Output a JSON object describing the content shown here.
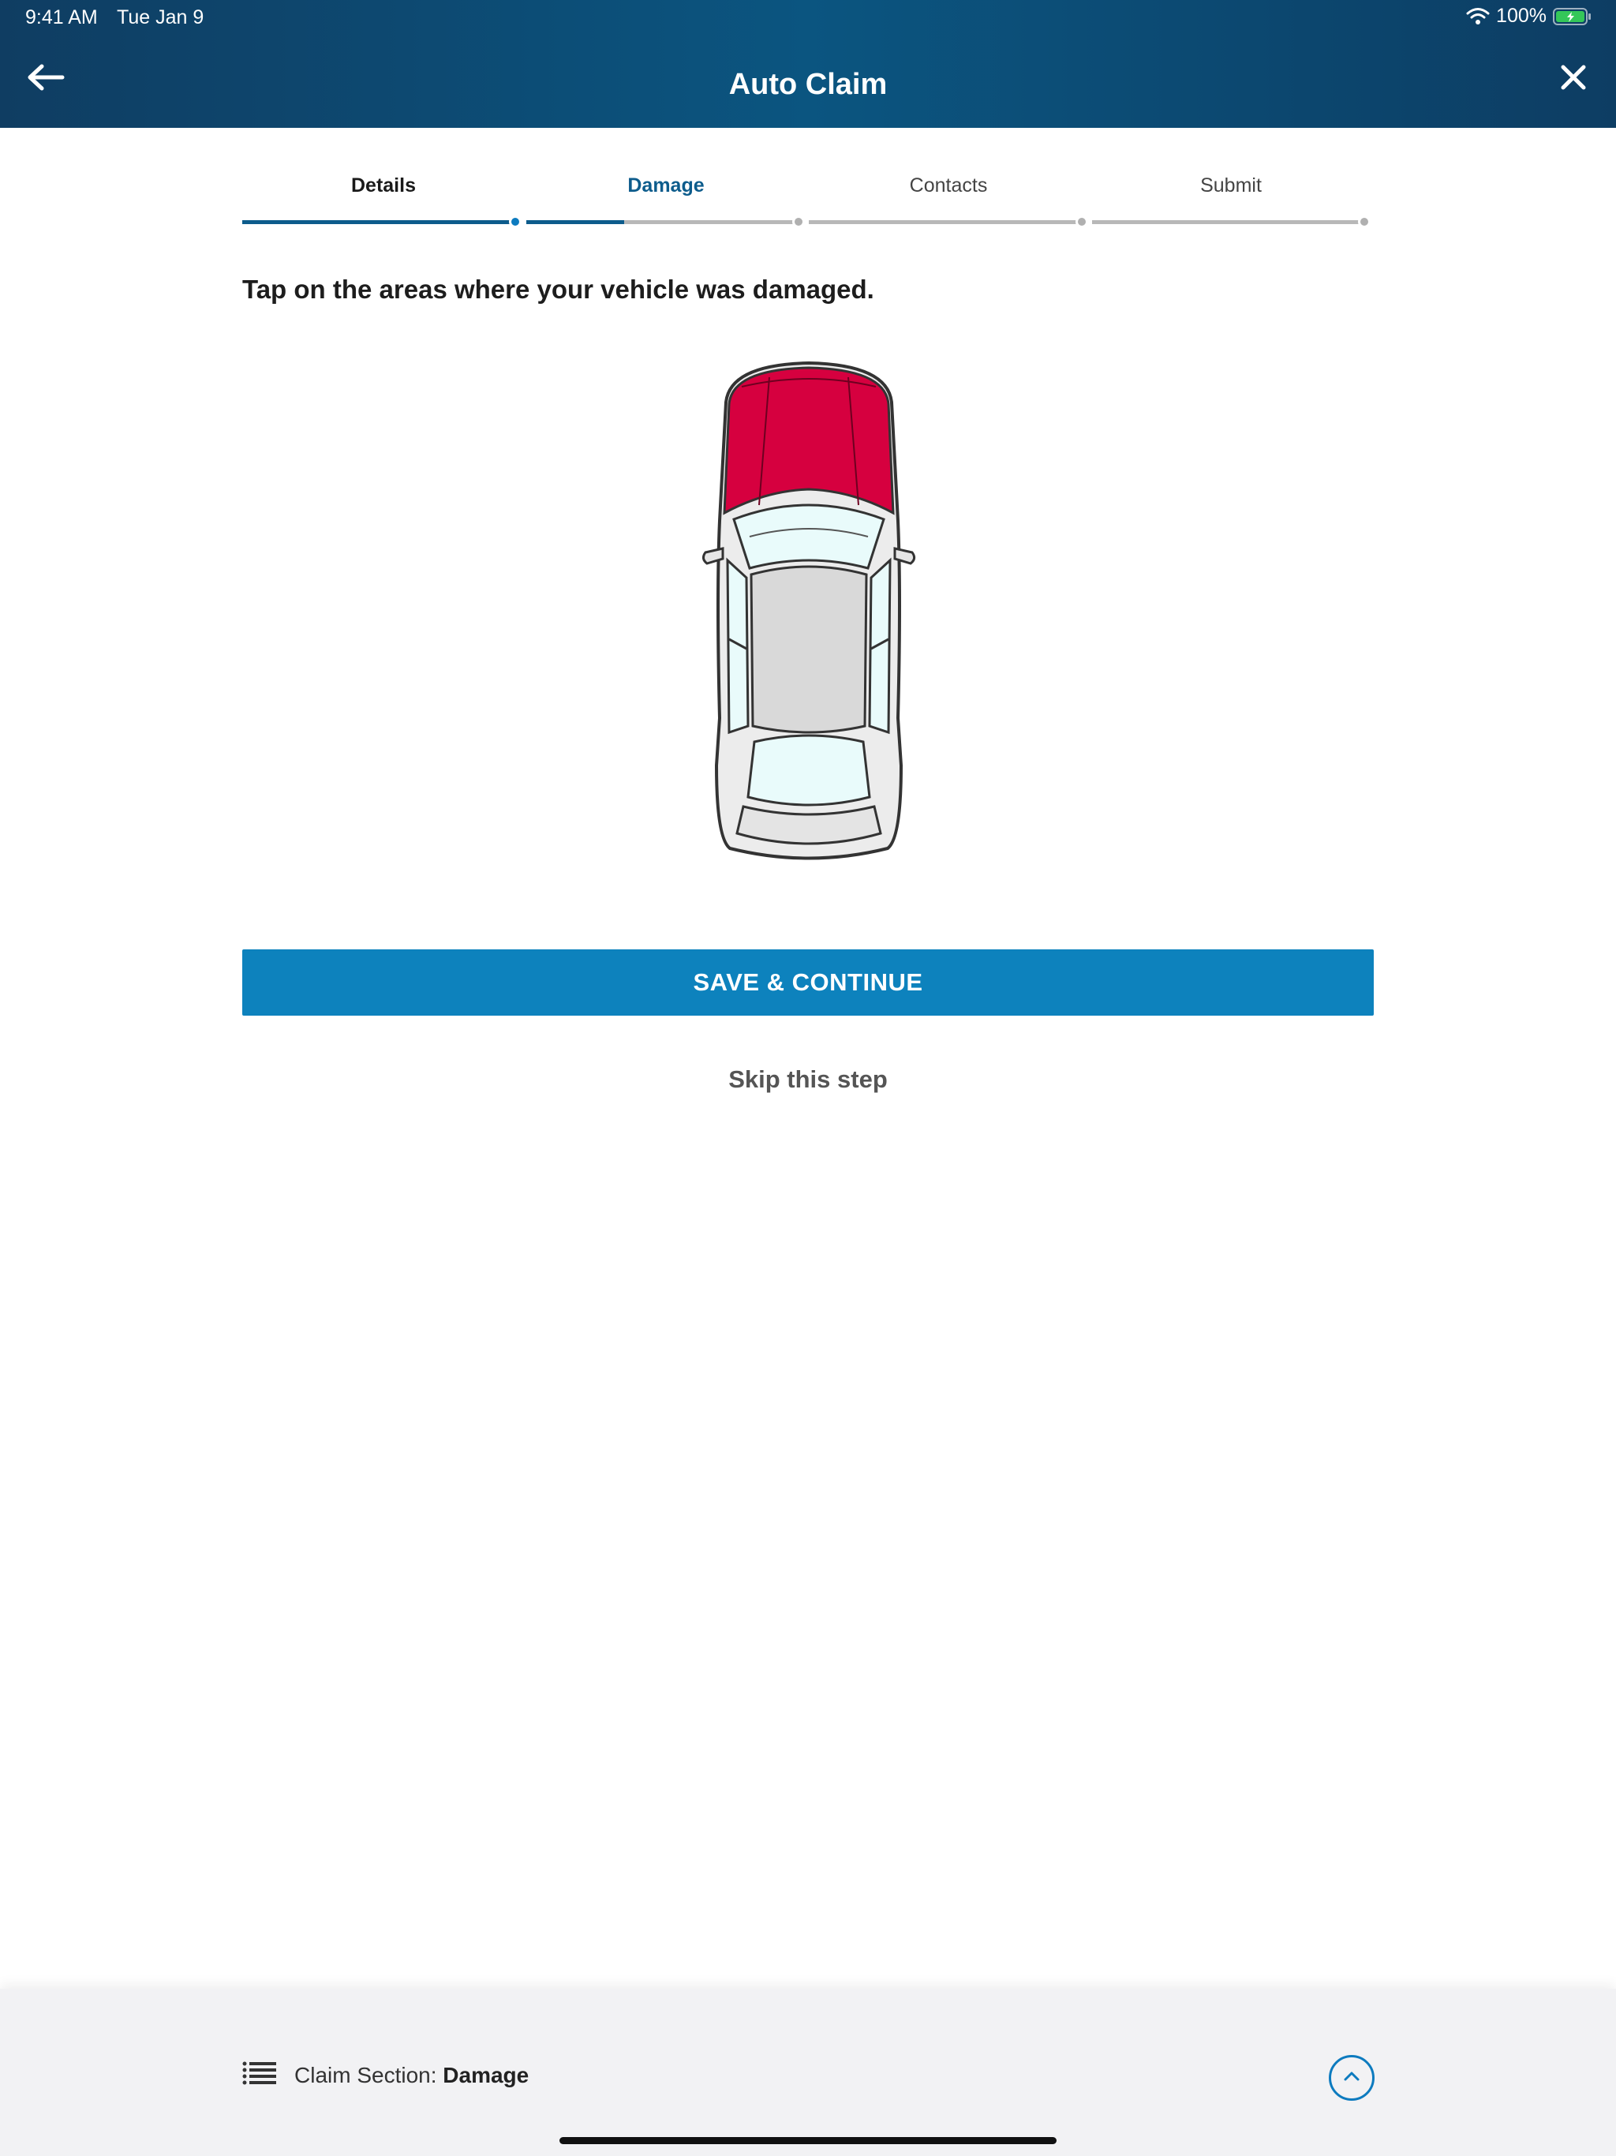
{
  "status_bar": {
    "time": "9:41 AM",
    "date": "Tue Jan 9",
    "battery": "100%",
    "icons": [
      "wifi-icon",
      "battery-charging-icon"
    ]
  },
  "header": {
    "title": "Auto Claim",
    "back_icon": "arrow-left-icon",
    "close_icon": "close-icon"
  },
  "stepper": {
    "steps": [
      {
        "label": "Details",
        "state": "complete"
      },
      {
        "label": "Damage",
        "state": "active"
      },
      {
        "label": "Contacts",
        "state": "upcoming"
      },
      {
        "label": "Submit",
        "state": "upcoming"
      }
    ]
  },
  "main": {
    "instruction": "Tap on the areas where your vehicle was damaged.",
    "selected_damage_areas": [
      "hood"
    ],
    "save_button": "SAVE & CONTINUE",
    "skip_link": "Skip this step"
  },
  "bottom_bar": {
    "section_label": "Claim Section:",
    "section_value": "Damage",
    "menu_icon": "list-icon",
    "expand_icon": "chevron-up-circle-icon"
  },
  "colors": {
    "header_bg": "#0b5580",
    "accent": "#0d82bd",
    "damage_selected": "#d6003f",
    "stepper_active": "#0d5c8c"
  }
}
